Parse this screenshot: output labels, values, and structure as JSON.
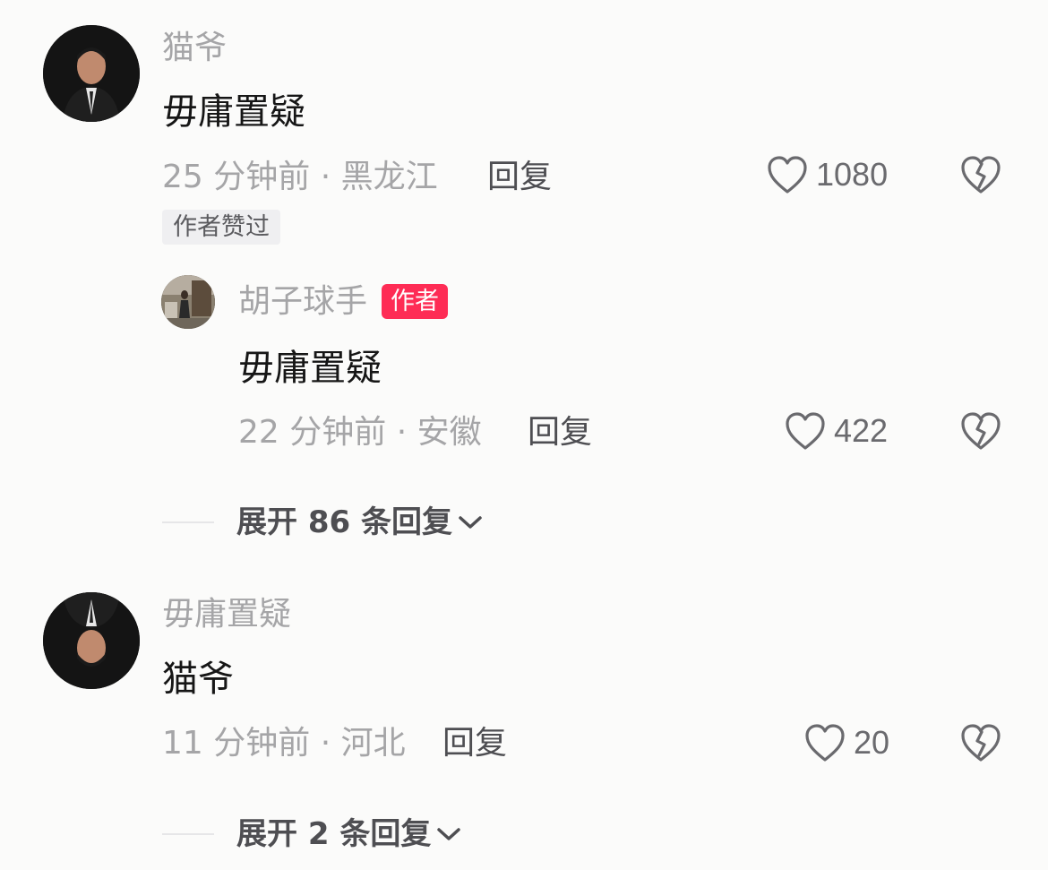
{
  "comments": [
    {
      "username": "猫爷",
      "text": "毋庸置疑",
      "time_location": "25 分钟前 · 黑龙江",
      "reply_label": "回复",
      "likes": "1080",
      "badge": "作者赞过",
      "replies": [
        {
          "username": "胡子球手",
          "author_badge": "作者",
          "text": "毋庸置疑",
          "time_location": "22 分钟前 · 安徽",
          "reply_label": "回复",
          "likes": "422"
        }
      ],
      "expand_label": "展开 86 条回复"
    },
    {
      "username": "毋庸置疑",
      "text": "猫爷",
      "time_location": "11 分钟前 · 河北",
      "reply_label": "回复",
      "likes": "20",
      "expand_label": "展开 2 条回复"
    }
  ],
  "icons": {
    "like": "heart-outline-icon",
    "dislike": "broken-heart-icon",
    "expand": "chevron-down-icon"
  },
  "colors": {
    "author_badge": "#fe2c55",
    "muted_text": "#a5a5a7",
    "primary_text": "#161616"
  }
}
